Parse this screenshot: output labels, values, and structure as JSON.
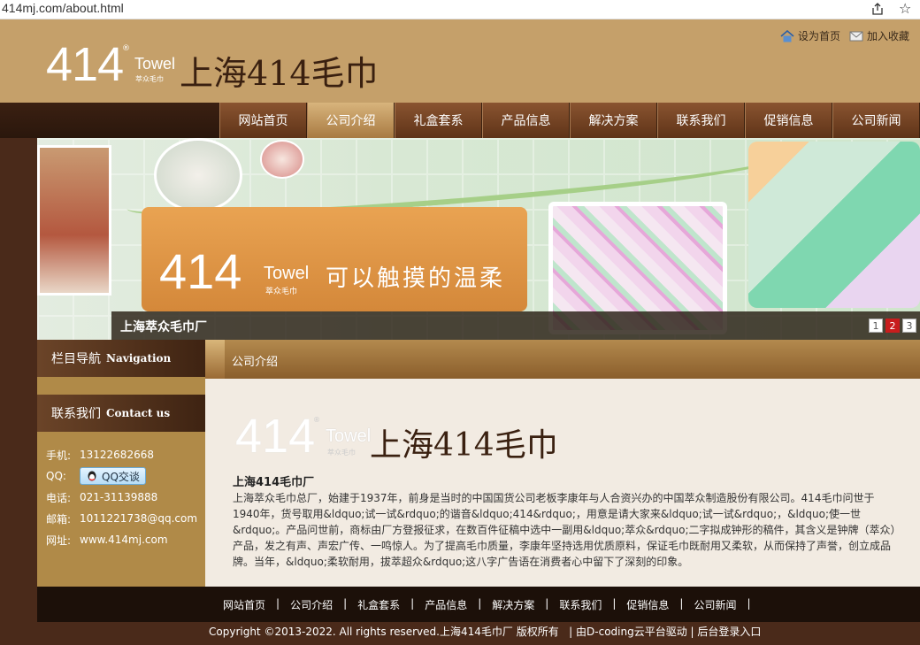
{
  "browser": {
    "url": "414mj.com/about.html"
  },
  "header": {
    "logo": {
      "num": "414",
      "reg": "®",
      "towel": "Towel",
      "sub": "萃众毛巾",
      "cn": "上海414毛巾"
    },
    "top_links": [
      {
        "label": "设为首页",
        "icon": "home-icon"
      },
      {
        "label": "加入收藏",
        "icon": "mail-icon"
      }
    ]
  },
  "nav": [
    {
      "label": "网站首页",
      "active": false
    },
    {
      "label": "公司介绍",
      "active": true
    },
    {
      "label": "礼盒套系",
      "active": false
    },
    {
      "label": "产品信息",
      "active": false
    },
    {
      "label": "解决方案",
      "active": false
    },
    {
      "label": "联系我们",
      "active": false
    },
    {
      "label": "促销信息",
      "active": false
    },
    {
      "label": "公司新闻",
      "active": false
    }
  ],
  "banner": {
    "num": "414",
    "towel": "Towel",
    "towel_sub": "萃众毛巾",
    "slogan": "可以触摸的温柔",
    "caption": "上海萃众毛巾厂",
    "slides": [
      "1",
      "2",
      "3"
    ],
    "active_slide": 2
  },
  "sidebar": {
    "nav_head": {
      "cn": "栏目导航",
      "en": "Navigation"
    },
    "contact_head": {
      "cn": "联系我们",
      "en": "Contact us"
    },
    "contact": {
      "phone_label": "手机:",
      "phone": "13122682668",
      "qq_label": "QQ:",
      "qq_button": "QQ交谈",
      "tel_label": "电话:",
      "tel": "021-31139888",
      "email_label": "邮箱:",
      "email": "1011221738@qq.com",
      "web_label": "网址:",
      "web": "www.414mj.com"
    }
  },
  "main": {
    "title": "公司介绍",
    "logo": {
      "num": "414",
      "reg": "®",
      "towel": "Towel",
      "sub": "萃众毛巾",
      "cn": "上海414毛巾"
    },
    "company_name": "上海414毛巾厂",
    "company_desc": "上海萃众毛巾总厂，始建于1937年，前身是当时的中国国货公司老板李康年与人合资兴办的中国萃众制造股份有限公司。414毛巾问世于1940年，货号取用&ldquo;试一试&rdquo;的谐音&ldquo;414&rdquo;，用意是请大家来&ldquo;试一试&rdquo;，&ldquo;使一世&rdquo;。产品问世前，商标由厂方登报征求，在数百件征稿中选中一副用&ldquo;萃众&rdquo;二字拟成钟形的稿件，其含义是钟牌（萃众）产品，发之有声、声宏广传、一鸣惊人。为了提高毛巾质量，李康年坚持选用优质原料，保证毛巾既耐用又柔软，从而保持了声誉，创立成品牌。当年，&ldquo;柔软耐用，拔萃超众&rdquo;这八字广告语在消费者心中留下了深刻的印象。"
  },
  "footer": {
    "links": [
      "网站首页",
      "公司介绍",
      "礼盒套系",
      "产品信息",
      "解决方案",
      "联系我们",
      "促销信息",
      "公司新闻"
    ],
    "separator": "|",
    "copyright": "Copyright ©2013-2022. All rights reserved.上海414毛巾厂 版权所有",
    "powered": "由D-coding云平台驱动",
    "admin": "后台登录入口"
  }
}
